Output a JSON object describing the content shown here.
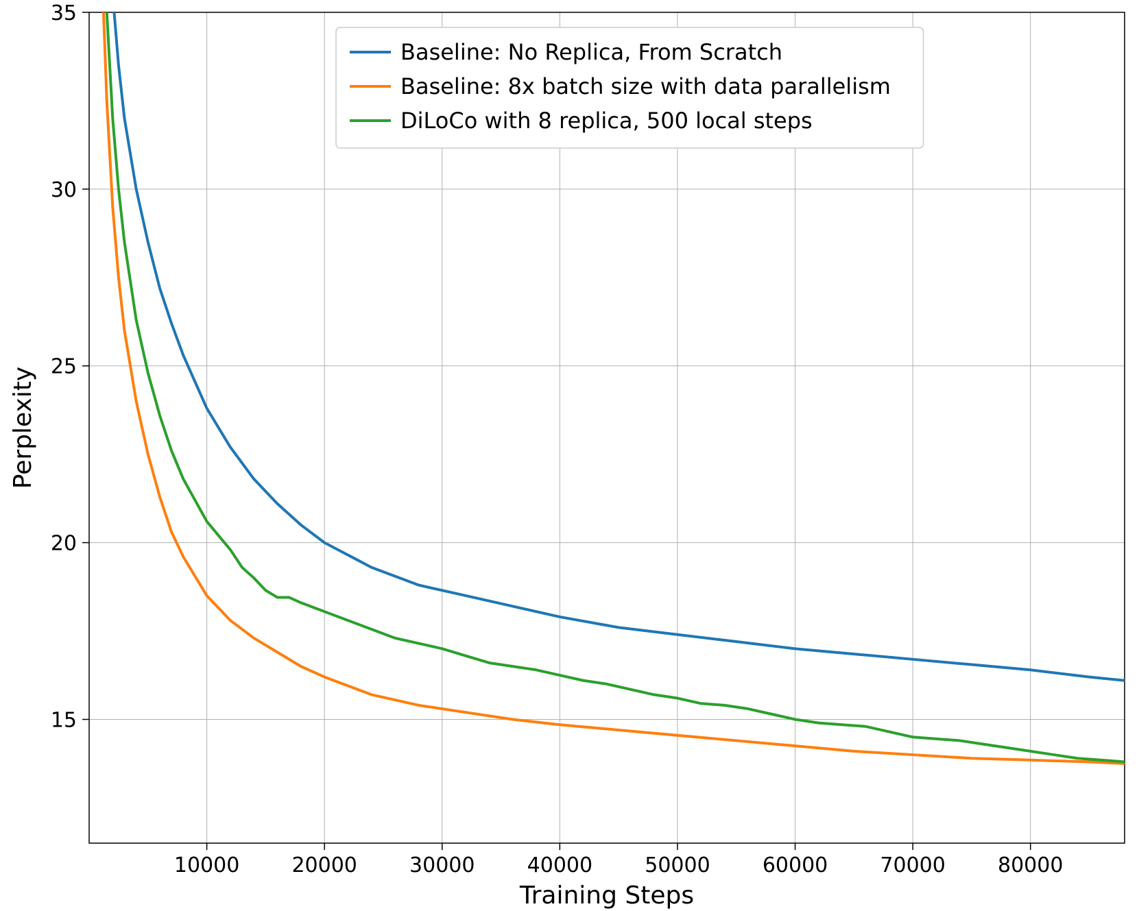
{
  "chart_data": {
    "type": "line",
    "xlabel": "Training Steps",
    "ylabel": "Perplexity",
    "xlim": [
      0,
      88000
    ],
    "ylim": [
      11.5,
      35
    ],
    "xticks": [
      10000,
      20000,
      30000,
      40000,
      50000,
      60000,
      70000,
      80000
    ],
    "yticks": [
      15,
      20,
      25,
      30,
      35
    ],
    "colors": {
      "baseline_scratch": "#1f77b4",
      "baseline_8x": "#ff7f0e",
      "diloco": "#2ca02c"
    },
    "series": [
      {
        "name": "Baseline: No Replica, From Scratch",
        "color": "#1f77b4",
        "x": [
          500,
          1000,
          1500,
          2000,
          2500,
          3000,
          4000,
          5000,
          6000,
          7000,
          8000,
          10000,
          12000,
          14000,
          16000,
          18000,
          20000,
          24000,
          28000,
          32000,
          36000,
          40000,
          45000,
          50000,
          55000,
          60000,
          65000,
          70000,
          75000,
          80000,
          85000,
          88000
        ],
        "y": [
          48,
          42,
          38,
          35.5,
          33.5,
          32,
          30,
          28.5,
          27.2,
          26.2,
          25.3,
          23.8,
          22.7,
          21.8,
          21.1,
          20.5,
          20.0,
          19.3,
          18.8,
          18.5,
          18.2,
          17.9,
          17.6,
          17.4,
          17.2,
          17.0,
          16.85,
          16.7,
          16.55,
          16.4,
          16.2,
          16.1
        ]
      },
      {
        "name": "Baseline: 8x batch size with data parallelism",
        "color": "#ff7f0e",
        "x": [
          500,
          1000,
          1500,
          2000,
          2500,
          3000,
          4000,
          5000,
          6000,
          7000,
          8000,
          10000,
          12000,
          14000,
          16000,
          18000,
          20000,
          24000,
          28000,
          32000,
          36000,
          40000,
          45000,
          50000,
          55000,
          60000,
          65000,
          70000,
          75000,
          80000,
          85000,
          88000
        ],
        "y": [
          45,
          37,
          32.5,
          29.5,
          27.5,
          26,
          24,
          22.5,
          21.3,
          20.3,
          19.6,
          18.5,
          17.8,
          17.3,
          16.9,
          16.5,
          16.2,
          15.7,
          15.4,
          15.2,
          15.0,
          14.85,
          14.7,
          14.55,
          14.4,
          14.25,
          14.1,
          14.0,
          13.9,
          13.85,
          13.8,
          13.75
        ]
      },
      {
        "name": "DiLoCo with 8 replica, 500 local steps",
        "color": "#2ca02c",
        "x": [
          500,
          1000,
          1500,
          2000,
          2500,
          3000,
          4000,
          5000,
          6000,
          7000,
          8000,
          10000,
          12000,
          13000,
          14000,
          15000,
          16000,
          17000,
          18000,
          20000,
          22000,
          24000,
          26000,
          28000,
          30000,
          32000,
          34000,
          36000,
          38000,
          40000,
          42000,
          44000,
          46000,
          48000,
          50000,
          52000,
          54000,
          56000,
          58000,
          60000,
          62000,
          64000,
          66000,
          68000,
          70000,
          72000,
          74000,
          76000,
          78000,
          80000,
          82000,
          84000,
          86000,
          88000
        ],
        "y": [
          46,
          40,
          35,
          32,
          30,
          28.5,
          26.3,
          24.8,
          23.6,
          22.6,
          21.8,
          20.6,
          19.8,
          19.3,
          19.0,
          18.65,
          18.45,
          18.45,
          18.3,
          18.05,
          17.8,
          17.55,
          17.3,
          17.15,
          17.0,
          16.8,
          16.6,
          16.5,
          16.4,
          16.25,
          16.1,
          16.0,
          15.85,
          15.7,
          15.6,
          15.45,
          15.4,
          15.3,
          15.15,
          15.0,
          14.9,
          14.85,
          14.8,
          14.65,
          14.5,
          14.45,
          14.4,
          14.3,
          14.2,
          14.1,
          14.0,
          13.9,
          13.85,
          13.8
        ]
      }
    ],
    "legend_position": "upper right"
  }
}
